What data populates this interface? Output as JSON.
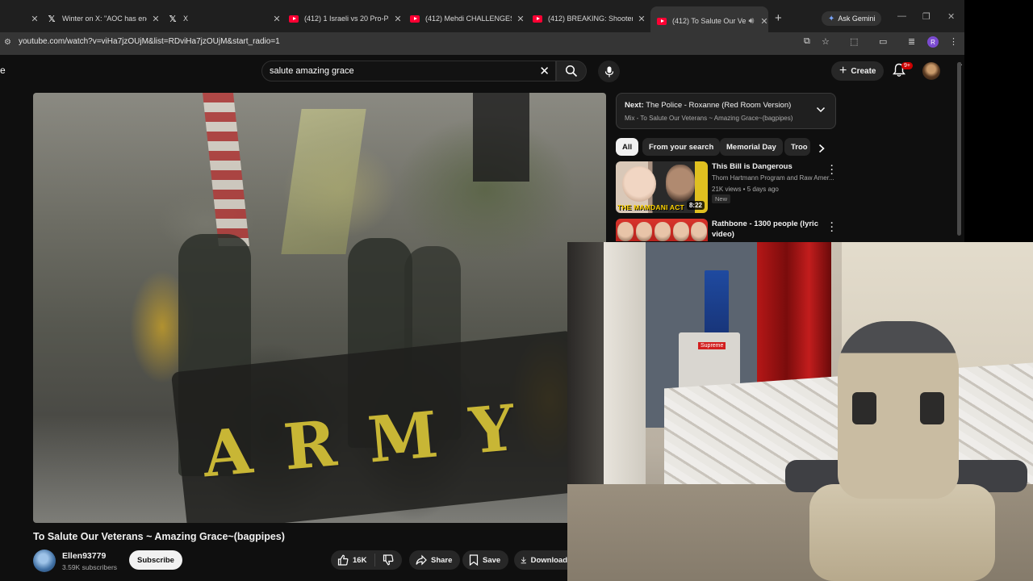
{
  "browser": {
    "tabs": [
      {
        "icon": "partial",
        "title": "",
        "active": false
      },
      {
        "icon": "x-logo",
        "title": "Winter on X: \"AOC has ende",
        "active": false
      },
      {
        "icon": "x-logo",
        "title": "X",
        "active": false
      },
      {
        "icon": "youtube-logo",
        "title": "(412) 1 Israeli vs 20 Pro-Pale",
        "active": false
      },
      {
        "icon": "youtube-logo",
        "title": "(412) Mehdi CHALLENGES G",
        "active": false
      },
      {
        "icon": "youtube-logo",
        "title": "(412) BREAKING: Shooter's I",
        "active": false
      },
      {
        "icon": "youtube-logo",
        "title": "(412) To Salute Our Vete",
        "active": true
      }
    ],
    "gemini_label": "Ask Gemini",
    "url": "youtube.com/watch?v=viHa7jzOUjM&list=RDviHa7jzOUjM&start_radio=1",
    "profile_initial": "R"
  },
  "youtube": {
    "search_value": "salute amazing grace",
    "create_label": "Create",
    "notif_count": "9+",
    "video": {
      "title": "To Salute Our Veterans ~ Amazing Grace~(bagpipes)",
      "overlay_text": "ARMY",
      "channel": "Ellen93779",
      "subscribers": "3.59K subscribers",
      "subscribe_label": "Subscribe",
      "likes": "16K",
      "share_label": "Share",
      "save_label": "Save",
      "download_label": "Download"
    },
    "next": {
      "prefix": "Next:",
      "title": "The Police - Roxanne (Red Room Version)",
      "mix": "Mix - To Salute Our Veterans ~ Amazing Grace~(bagpipes)"
    },
    "chips": [
      "All",
      "From your search",
      "Memorial Day",
      "Troo"
    ],
    "recommendations": [
      {
        "title": "This Bill is Dangerous",
        "channel": "Thom Hartmann Program and Raw Amer...",
        "meta": "21K views • 5 days ago",
        "badge": "New",
        "duration": "8:22",
        "thumb_text": "THE MAMDANI ACT"
      },
      {
        "title": "Rathbone - 1300 people (lyric video)"
      }
    ]
  },
  "webcam": {
    "box_label": "Supreme"
  },
  "colors": {
    "page_bg": "#0f0f0f",
    "youtube_red": "#ff0033",
    "tabstrip_bg": "#1f1f1f",
    "active_tab_bg": "#353535",
    "chip_selected": "#f1f1f1"
  }
}
